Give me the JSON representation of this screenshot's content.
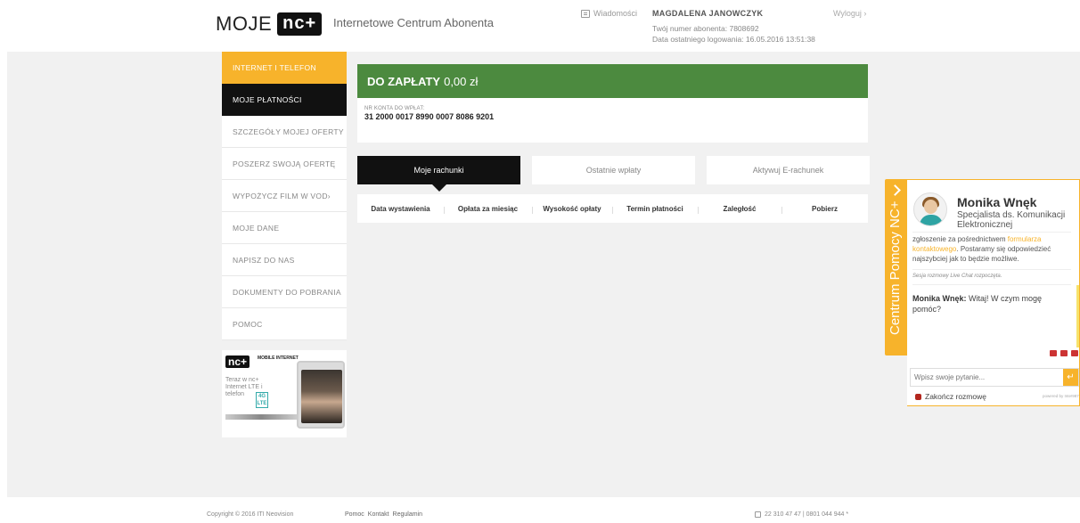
{
  "header": {
    "logo_text": "MOJE",
    "logo_badge": "nc+",
    "subtitle": "Internetowe Centrum Abonenta",
    "messages_label": "Wiadomości",
    "user_name": "MAGDALENA JANOWCZYK",
    "subscriber_number": "Twój numer abonenta: 7808692",
    "last_login": "Data ostatniego logowania: 16.05.2016 13:51:38",
    "logout_label": "Wyloguj ›"
  },
  "sidebar": {
    "items": [
      {
        "label": "INTERNET I TELEFON"
      },
      {
        "label": "MOJE PŁATNOŚCI"
      },
      {
        "label": "SZCZEGÓŁY MOJEJ OFERTY"
      },
      {
        "label": "POSZERZ SWOJĄ OFERTĘ"
      },
      {
        "label": "WYPOŻYCZ FILM W VOD›"
      },
      {
        "label": "MOJE DANE"
      },
      {
        "label": "NAPISZ DO NAS"
      },
      {
        "label": "DOKUMENTY DO POBRANIA"
      },
      {
        "label": "POMOC"
      }
    ],
    "promo": {
      "logo": "nc+",
      "tag": "MOBILE INTERNET",
      "text": "Teraz w nc+ Internet LTE i telefon",
      "badge": "4G LTE"
    }
  },
  "payment": {
    "label": "DO ZAPŁATY",
    "amount": "0,00 zł",
    "account_label": "NR KONTA DO WPŁAT:",
    "account_number": "31 2000 0017 8990 0007 8086 9201"
  },
  "tabs": [
    {
      "label": "Moje rachunki"
    },
    {
      "label": "Ostatnie wpłaty"
    },
    {
      "label": "Aktywuj E-rachunek"
    }
  ],
  "table": {
    "columns": [
      "Data wystawienia",
      "Opłata za miesiąc",
      "Wysokość opłaty",
      "Termin płatności",
      "Zaległość",
      "Pobierz"
    ]
  },
  "chat": {
    "tab_label": "Centrum Pomocy NC+",
    "agent_name": "Monika Wnęk",
    "agent_role": "Specjalista ds. Komunikacji Elektronicznej",
    "text_before_link": "zgłoszenie za pośrednictwem ",
    "link_text": "formularza kontaktowego",
    "text_after_link": ". Postaramy się odpowiedzieć najszybciej jak to będzie możliwe.",
    "system_msg": "Sesja rozmowy Live Chat rozpoczęta.",
    "msg_author": "Monika Wnęk:",
    "msg_text": "Witaj! W czym mogę pomóc?",
    "input_placeholder": "Wpisz swoje pytanie...",
    "end_label": "Zakończ rozmowę",
    "powered_by": "powered by Inte!987"
  },
  "footer": {
    "copyright": "Copyright © 2016 ITI Neovision",
    "links": [
      "Pomoc",
      "Kontakt",
      "Regulamin"
    ],
    "phone": "22 310 47 47  |  0801 044 944 *"
  },
  "colors": {
    "accent_orange": "#f7b32b",
    "pay_green": "#4c8a3f",
    "active_black": "#111111"
  }
}
